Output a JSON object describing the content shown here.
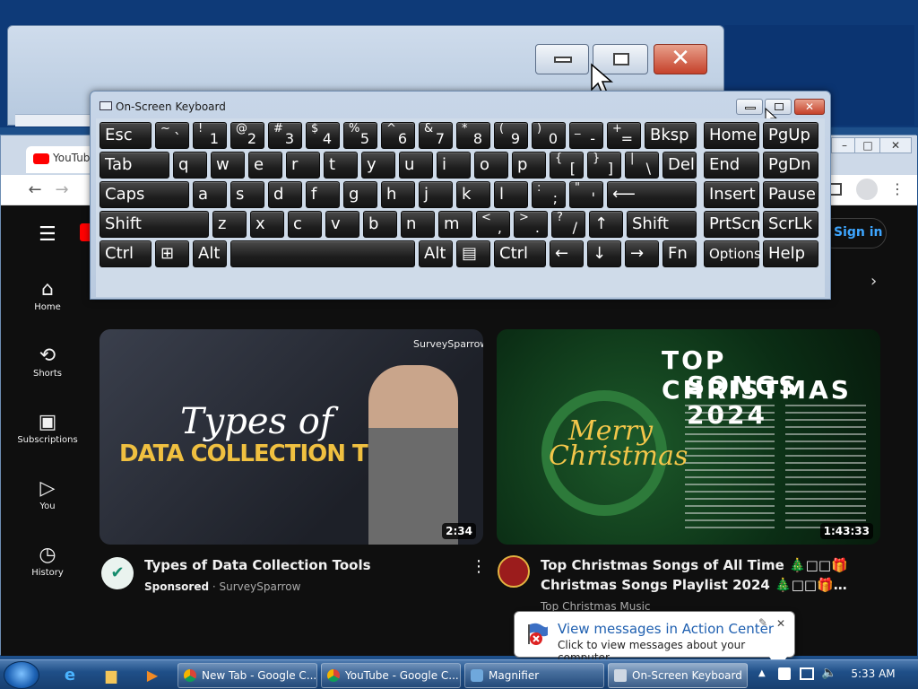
{
  "chrome": {
    "tab_title": "YouTube",
    "minimize": "–",
    "maximize": "□",
    "close": "✕"
  },
  "youtube": {
    "sidebar": [
      {
        "label": "Home",
        "icon": "home-icon"
      },
      {
        "label": "Shorts",
        "icon": "shorts-icon"
      },
      {
        "label": "Subscriptions",
        "icon": "subscriptions-icon"
      },
      {
        "label": "You",
        "icon": "you-icon"
      },
      {
        "label": "History",
        "icon": "history-icon"
      }
    ],
    "sign_in": "Sign in",
    "videos": [
      {
        "title": "Types of Data Collection Tools",
        "meta_bold": "Sponsored",
        "meta": " · SurveySparrow",
        "duration": "2:34",
        "thumb_script": "Types of",
        "thumb_headline": "DATA COLLECTION TOOLS",
        "thumb_brand": "SurveySparrow"
      },
      {
        "title_line1": "Top Christmas Songs of All Time 🎄□□🎁",
        "title_line2": "Christmas Songs Playlist 2024 🎄□□🎁…",
        "channel": "Top Christmas Music",
        "duration": "1:43:33",
        "thumb_headline1": "TOP CHRISTMAS",
        "thumb_headline2": "SONGS 2024",
        "thumb_merry": "Merry",
        "thumb_christmas": "Christmas",
        "badge": "TOP CHRISTMAS MUSIC"
      }
    ]
  },
  "osk": {
    "title": "On-Screen Keyboard",
    "rows": [
      [
        {
          "t": "Esc",
          "w": 60
        },
        {
          "t": "`",
          "s": "~",
          "w": 40
        },
        {
          "t": "1",
          "s": "!",
          "w": 40
        },
        {
          "t": "2",
          "s": "@",
          "w": 40
        },
        {
          "t": "3",
          "s": "#",
          "w": 40
        },
        {
          "t": "4",
          "s": "$",
          "w": 40
        },
        {
          "t": "5",
          "s": "%",
          "w": 40
        },
        {
          "t": "6",
          "s": "^",
          "w": 40
        },
        {
          "t": "7",
          "s": "&",
          "w": 40
        },
        {
          "t": "8",
          "s": "*",
          "w": 40
        },
        {
          "t": "9",
          "s": "(",
          "w": 40
        },
        {
          "t": "0",
          "s": ")",
          "w": 40
        },
        {
          "t": "-",
          "s": "_",
          "w": 40
        },
        {
          "t": "=",
          "s": "+",
          "w": 40
        },
        {
          "t": "Bksp",
          "w": 60
        },
        {
          "gap": 4
        },
        {
          "t": "Home",
          "w": 64
        },
        {
          "t": "PgUp",
          "w": 64
        }
      ],
      [
        {
          "t": "Tab",
          "w": 80
        },
        {
          "t": "q",
          "w": 40
        },
        {
          "t": "w",
          "w": 40
        },
        {
          "t": "e",
          "w": 40
        },
        {
          "t": "r",
          "w": 40
        },
        {
          "t": "t",
          "w": 40
        },
        {
          "t": "y",
          "w": 40
        },
        {
          "t": "u",
          "w": 40
        },
        {
          "t": "i",
          "w": 40
        },
        {
          "t": "o",
          "w": 40
        },
        {
          "t": "p",
          "w": 40
        },
        {
          "t": "[",
          "s": "{",
          "w": 40
        },
        {
          "t": "]",
          "s": "}",
          "w": 40
        },
        {
          "t": "\\",
          "s": "|",
          "w": 40
        },
        {
          "t": "Del",
          "w": 40
        },
        {
          "gap": 4
        },
        {
          "t": "End",
          "w": 64
        },
        {
          "t": "PgDn",
          "w": 64
        }
      ],
      [
        {
          "t": "Caps",
          "w": 102
        },
        {
          "t": "a",
          "w": 40
        },
        {
          "t": "s",
          "w": 40
        },
        {
          "t": "d",
          "w": 40
        },
        {
          "t": "f",
          "w": 40
        },
        {
          "t": "g",
          "w": 40
        },
        {
          "t": "h",
          "w": 40
        },
        {
          "t": "j",
          "w": 40
        },
        {
          "t": "k",
          "w": 40
        },
        {
          "t": "l",
          "w": 40
        },
        {
          "t": ";",
          "s": ":",
          "w": 40
        },
        {
          "t": "'",
          "s": "\"",
          "w": 40
        },
        {
          "t": "⟵",
          "w": 102
        },
        {
          "gap": 4
        },
        {
          "t": "Insert",
          "w": 64
        },
        {
          "t": "Pause",
          "w": 64
        }
      ],
      [
        {
          "t": "Shift",
          "w": 124
        },
        {
          "t": "z",
          "w": 40
        },
        {
          "t": "x",
          "w": 40
        },
        {
          "t": "c",
          "w": 40
        },
        {
          "t": "v",
          "w": 40
        },
        {
          "t": "b",
          "w": 40
        },
        {
          "t": "n",
          "w": 40
        },
        {
          "t": "m",
          "w": 40
        },
        {
          "t": ",",
          "s": "<",
          "w": 40
        },
        {
          "t": ".",
          "s": ">",
          "w": 40
        },
        {
          "t": "/",
          "s": "?",
          "w": 40
        },
        {
          "t": "↑",
          "w": 40
        },
        {
          "t": "Shift",
          "w": 80
        },
        {
          "gap": 4
        },
        {
          "t": "PrtScn",
          "w": 64
        },
        {
          "t": "ScrLk",
          "w": 64
        }
      ],
      [
        {
          "t": "Ctrl",
          "w": 60
        },
        {
          "t": "⊞",
          "w": 40
        },
        {
          "t": "Alt",
          "w": 40
        },
        {
          "t": "",
          "w": 208
        },
        {
          "t": "Alt",
          "w": 40
        },
        {
          "t": "▤",
          "w": 40
        },
        {
          "t": "Ctrl",
          "w": 60
        },
        {
          "t": "←",
          "w": 40
        },
        {
          "t": "↓",
          "w": 40
        },
        {
          "t": "→",
          "w": 40
        },
        {
          "t": "Fn",
          "w": 40
        },
        {
          "gap": 4
        },
        {
          "t": "Options",
          "w": 64,
          "small": true
        },
        {
          "t": "Help",
          "w": 64
        }
      ]
    ]
  },
  "balloon": {
    "title": "View messages in Action Center",
    "text": "Click to view messages about your computer."
  },
  "taskbar": {
    "items": [
      {
        "label": "New Tab - Google C...",
        "color": "#e8b400"
      },
      {
        "label": "YouTube - Google C...",
        "color": "#e8b400"
      },
      {
        "label": "Magnifier",
        "color": "#6fa8dc"
      },
      {
        "label": "On-Screen Keyboard",
        "color": "#cfd8e3"
      }
    ],
    "clock": "5:33 AM"
  }
}
